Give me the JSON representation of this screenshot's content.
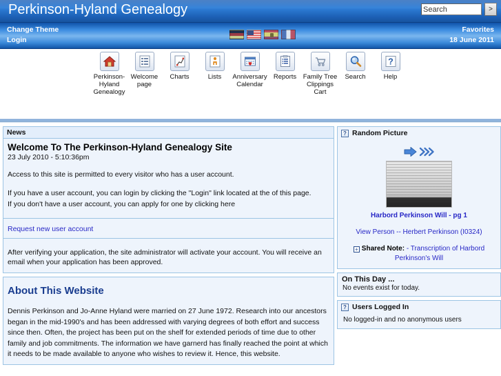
{
  "header": {
    "site_title": "Perkinson-Hyland Genealogy",
    "search": {
      "value": "Search",
      "placeholder": "Search",
      "go_label": ">"
    },
    "change_theme": "Change Theme",
    "login": "Login",
    "favorites": "Favorites",
    "date": "18 June 2011",
    "flags": [
      {
        "name": "flag-germany",
        "code": "de"
      },
      {
        "name": "flag-united-states",
        "code": "us"
      },
      {
        "name": "flag-spain",
        "code": "es"
      },
      {
        "name": "flag-france",
        "code": "fr"
      }
    ]
  },
  "toolbar": {
    "items": [
      {
        "label": "Perkinson-Hyland Genealogy",
        "icon": "home-icon"
      },
      {
        "label": "Welcome page",
        "icon": "list-page-icon"
      },
      {
        "label": "Charts",
        "icon": "charts-icon"
      },
      {
        "label": "Lists",
        "icon": "person-icon"
      },
      {
        "label": "Anniversary Calendar",
        "icon": "calendar-heart-icon"
      },
      {
        "label": "Reports",
        "icon": "clipboard-icon"
      },
      {
        "label": "Family Tree Clippings Cart",
        "icon": "shopping-cart-icon"
      },
      {
        "label": "Search",
        "icon": "magnifier-icon"
      },
      {
        "label": "Help",
        "icon": "question-mark-icon"
      }
    ]
  },
  "news": {
    "panel_title": "News",
    "headline": "Welcome To The Perkinson-Hyland Genealogy Site",
    "date": "23 July 2010 - 5:10:36pm",
    "paragraph1": "Access to this site is permitted to every visitor who has a user account.",
    "paragraph2_line1": "If you have a user account, you can login by clicking the \"Login\" link located at the of this page.",
    "paragraph2_line2": "If you don't have a user account, you can apply for one by clicking here",
    "request_link": "Request new user account",
    "paragraph3": "After verifying your application, the site administrator will activate your account. You will receive an email when your application has been approved."
  },
  "about": {
    "heading": "About This Website",
    "body": "Dennis Perkinson and Jo-Anne Hyland were married on 27 June 1972. Research into our ancestors began in the mid-1990's and has been addressed with varying degrees of both effort and success since then. Often, the project has been put on the shelf for extended periods of time due to other family and job commitments. The information we have garnerd has finally reached the point at which it needs to be made available to anyone who wishes to review it. Hence, this website."
  },
  "random_picture": {
    "title": "Random Picture",
    "help_icon": "?",
    "next_arrow": "next-picture-arrow",
    "skip_arrow": "skip-pictures-arrow",
    "image_caption": "Harbord Perkinson Will - pg 1",
    "person_link": "View Person -- Herbert Perkinson  (I0324)",
    "note_expander": "+",
    "note_label": "Shared Note:",
    "note_text": "- Transcription of Harbord Perkinson's Will"
  },
  "on_this_day": {
    "title": "On This Day ...",
    "text": "No events exist for today."
  },
  "users_logged_in": {
    "title": "Users Logged In",
    "help_icon": "?",
    "text": "No logged-in and no anonymous users"
  },
  "colors": {
    "header_blue": "#1f62b8",
    "panel_border": "#9cc4e4",
    "panel_bg": "#eef4fc",
    "link_blue": "#2727c6",
    "heading_blue": "#1a3d8f"
  }
}
